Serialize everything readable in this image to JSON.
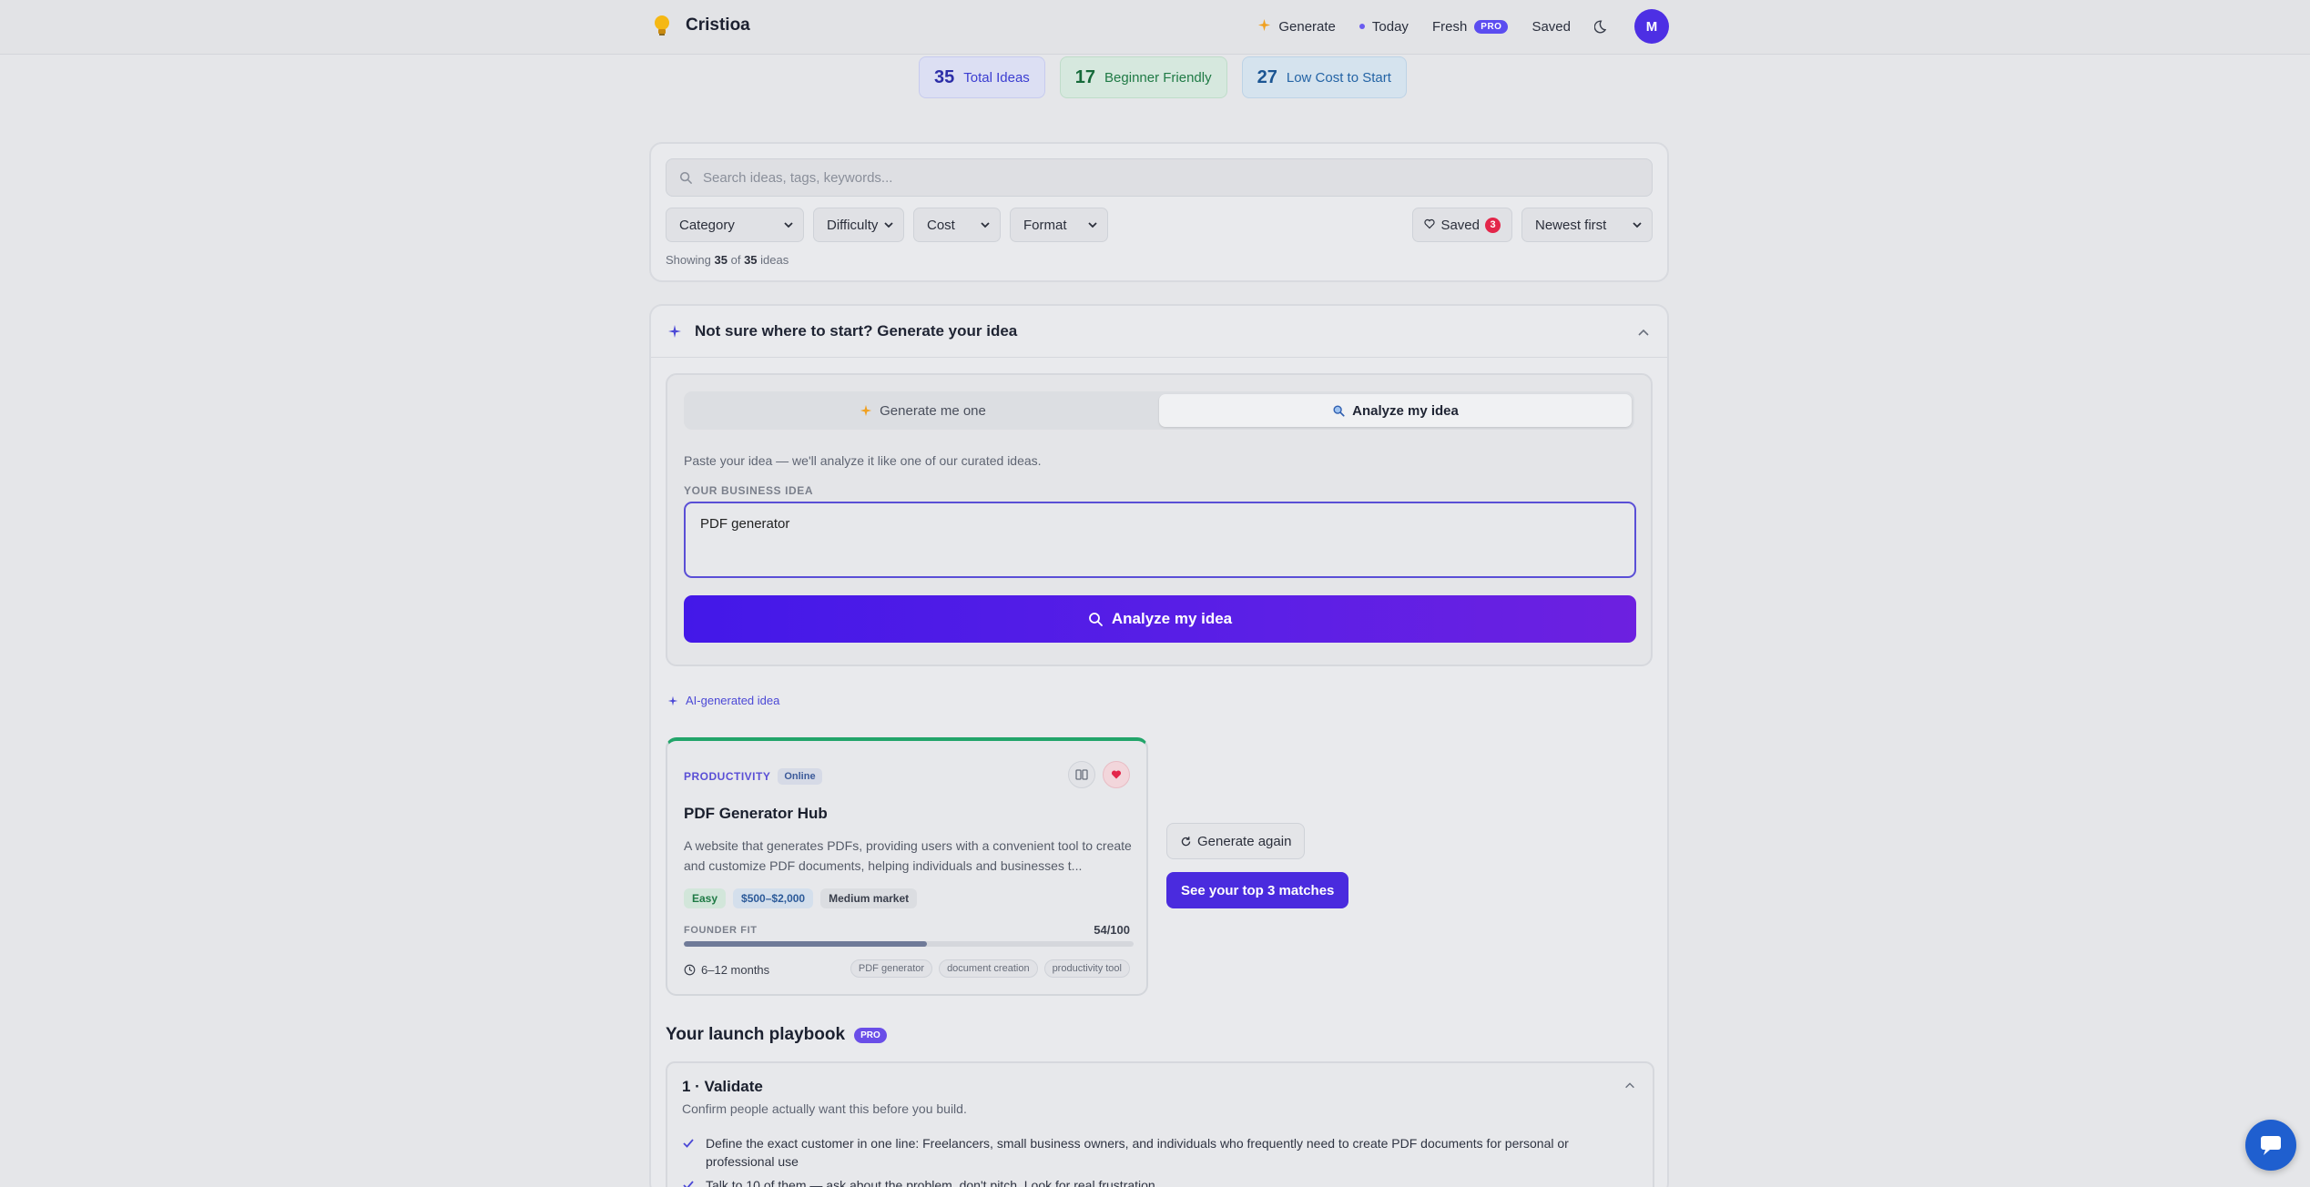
{
  "header": {
    "brand": "Cristioa",
    "nav": {
      "generate": "Generate",
      "today": "Today",
      "fresh": "Fresh",
      "fresh_badge": "PRO",
      "saved": "Saved"
    },
    "avatar_initial": "M"
  },
  "stats": [
    {
      "value": "35",
      "label": "Total Ideas"
    },
    {
      "value": "17",
      "label": "Beginner Friendly"
    },
    {
      "value": "27",
      "label": "Low Cost to Start"
    }
  ],
  "search": {
    "placeholder": "Search ideas, tags, keywords...",
    "filters": [
      "Category",
      "Difficulty",
      "Cost",
      "Format"
    ],
    "saved_label": "Saved",
    "saved_count": "3",
    "sort": "Newest first",
    "showing_prefix": "Showing",
    "showing_count": "35",
    "showing_of": "of",
    "showing_total": "35",
    "showing_suffix": "ideas"
  },
  "generator": {
    "title": "Not sure where to start? Generate your idea",
    "tabs": {
      "generate": "Generate me one",
      "analyze": "Analyze my idea"
    },
    "description": "Paste your idea — we'll analyze it like one of our curated ideas.",
    "field_label": "YOUR BUSINESS IDEA",
    "idea_value": "PDF generator",
    "analyze_button": "Analyze my idea",
    "ai_label": "AI-generated idea"
  },
  "idea_card": {
    "category": "PRODUCTIVITY",
    "format": "Online",
    "title": "PDF Generator Hub",
    "description": "A website that generates PDFs, providing users with a convenient tool to create and customize PDF documents, helping individuals and businesses t...",
    "difficulty": "Easy",
    "cost": "$500–$2,000",
    "market": "Medium market",
    "fit_label": "FOUNDER FIT",
    "fit_score": "54/100",
    "fit_value": 0.54,
    "timeline": "6–12 months",
    "tags": [
      "PDF generator",
      "document creation",
      "productivity tool"
    ]
  },
  "actions": {
    "regenerate": "Generate again",
    "matches": "See your top 3 matches"
  },
  "playbook": {
    "title": "Your launch playbook",
    "badge": "PRO",
    "step_title": "1 · Validate",
    "step_subtitle": "Confirm people actually want this before you build.",
    "items": [
      "Define the exact customer in one line: Freelancers, small business owners, and individuals who frequently need to create PDF documents for personal or professional use",
      "Talk to 10 of them — ask about the problem, don't pitch. Look for real frustration."
    ]
  },
  "colors": {
    "accent": "#4a2bde",
    "card_top": "#22a56a",
    "badge_red": "#e3264a"
  }
}
